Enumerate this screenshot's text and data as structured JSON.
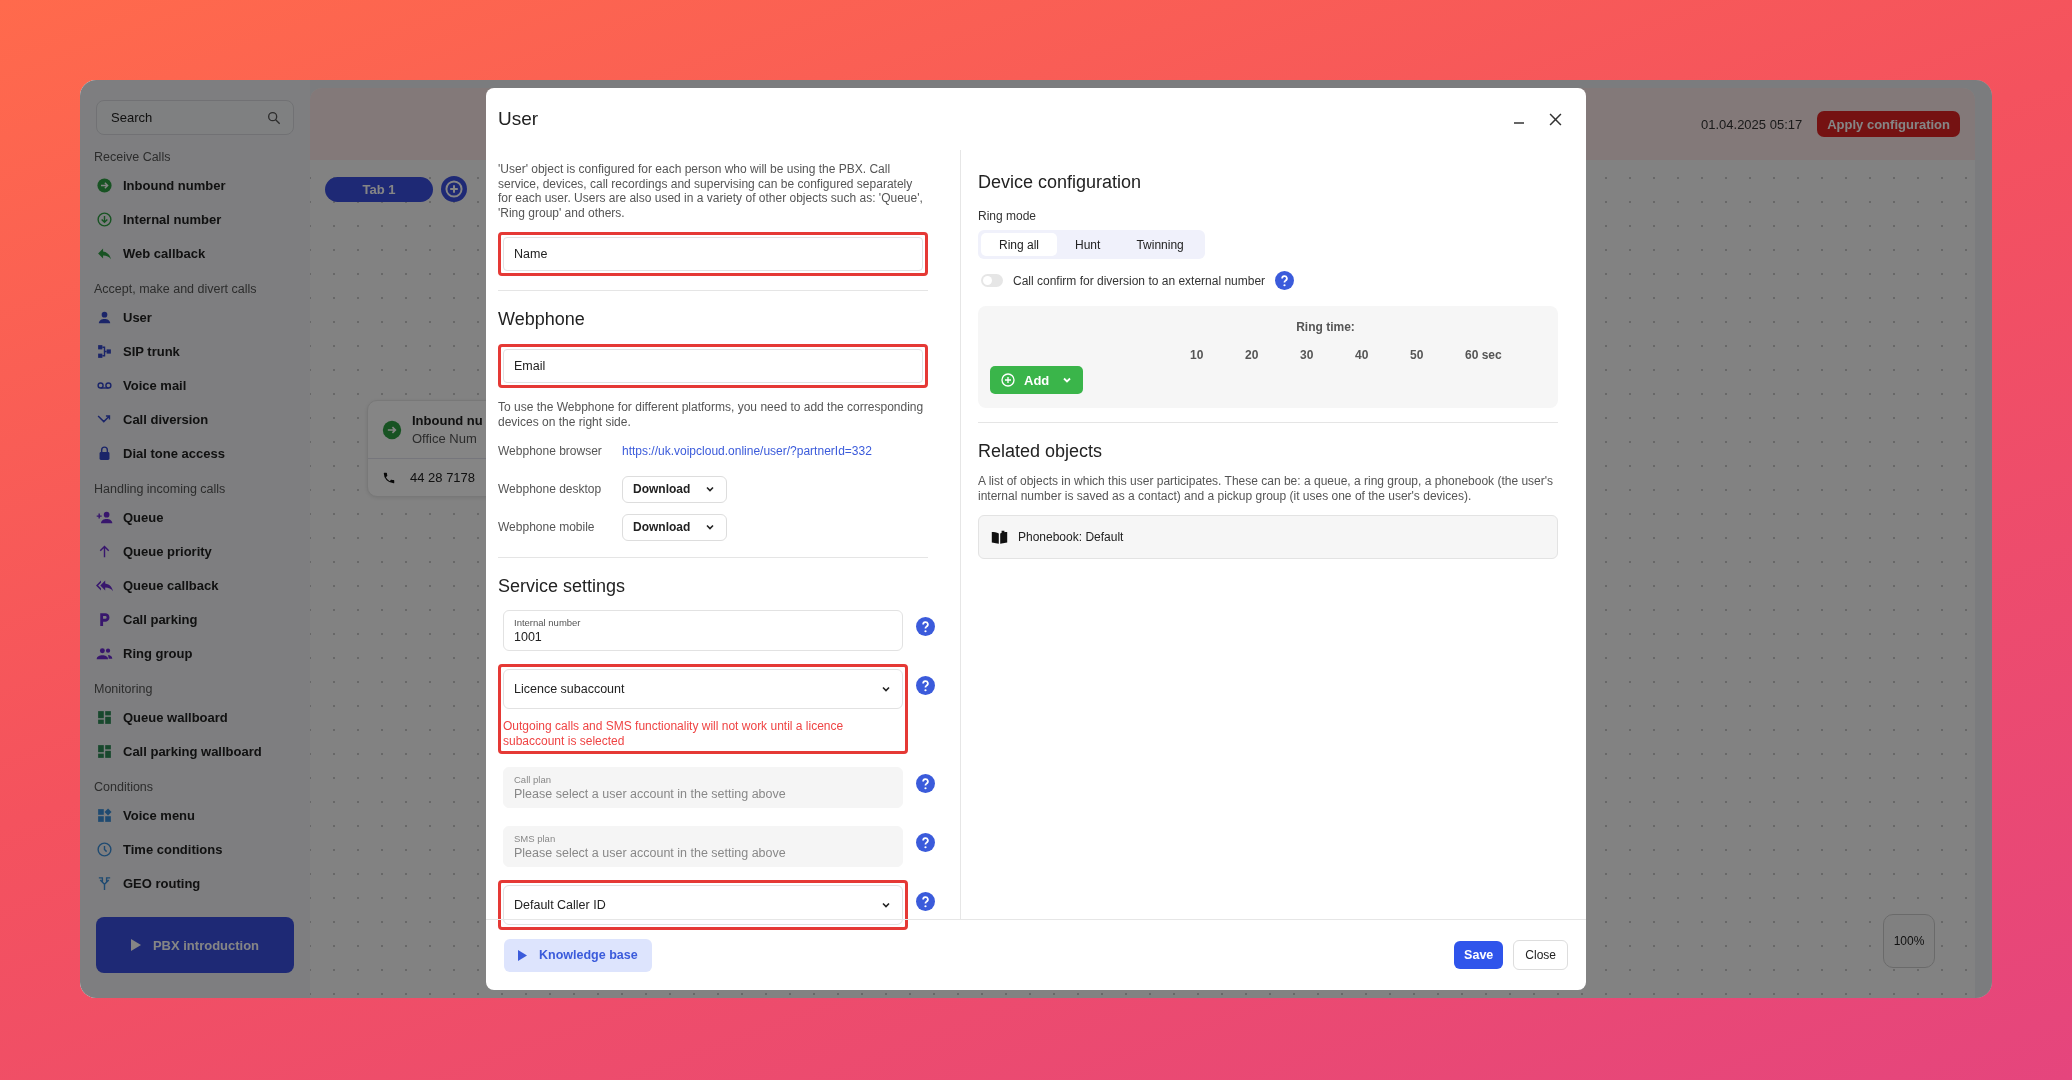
{
  "sidebar": {
    "search": {
      "placeholder": "Search"
    },
    "sections": [
      {
        "title": "Receive Calls",
        "items": [
          {
            "label": "Inbound number"
          },
          {
            "label": "Internal number"
          },
          {
            "label": "Web callback"
          }
        ]
      },
      {
        "title": "Accept, make and divert calls",
        "items": [
          {
            "label": "User"
          },
          {
            "label": "SIP trunk"
          },
          {
            "label": "Voice mail"
          },
          {
            "label": "Call diversion"
          },
          {
            "label": "Dial tone access"
          }
        ]
      },
      {
        "title": "Handling incoming calls",
        "items": [
          {
            "label": "Queue"
          },
          {
            "label": "Queue priority"
          },
          {
            "label": "Queue callback"
          },
          {
            "label": "Call parking"
          },
          {
            "label": "Ring group"
          }
        ]
      },
      {
        "title": "Monitoring",
        "items": [
          {
            "label": "Queue wallboard"
          },
          {
            "label": "Call parking wallboard"
          }
        ]
      },
      {
        "title": "Conditions",
        "items": [
          {
            "label": "Voice menu"
          },
          {
            "label": "Time conditions"
          },
          {
            "label": "GEO routing"
          }
        ]
      }
    ],
    "intro_button": "PBX introduction"
  },
  "canvas": {
    "datetime": "01.04.2025 05:17",
    "apply_button": "Apply configuration",
    "tabs": [
      {
        "label": "Tab 1",
        "selected": true
      }
    ],
    "node": {
      "title": "Inbound nu",
      "subtitle": "Office Num",
      "phone": "44 28 7178"
    },
    "zoom": "100%"
  },
  "dialog": {
    "title": "User",
    "description": "'User' object is configured for each person who will be using the PBX. Call service, devices, call recordings and supervising can be configured separately for each user. Users are also used in a variety of other objects such as: 'Queue', 'Ring group' and others.",
    "name_field": {
      "placeholder": "Name",
      "highlighted": true
    },
    "webphone": {
      "title": "Webphone",
      "email_field": {
        "placeholder": "Email",
        "highlighted": true
      },
      "note": "To use the Webphone for different platforms, you need to add the corresponding devices on the right side.",
      "rows": [
        {
          "kind": "link",
          "label": "Webphone browser",
          "value": "https://uk.voipcloud.online/user/?partnerId=332"
        },
        {
          "kind": "dropdown",
          "label": "Webphone desktop",
          "value": "Download"
        },
        {
          "kind": "dropdown",
          "label": "Webphone mobile",
          "value": "Download"
        }
      ]
    },
    "service_settings": {
      "title": "Service settings",
      "fields": [
        {
          "kind": "text",
          "label": "Internal number",
          "value": "1001",
          "disabled": false,
          "highlighted": false
        },
        {
          "kind": "select",
          "placeholder": "Licence subaccount",
          "error": "Outgoing calls and SMS functionality will not work until a licence subaccount is selected",
          "disabled": false,
          "highlighted": true
        },
        {
          "kind": "text",
          "label": "Call plan",
          "value": "Please select a user account in the setting above",
          "disabled": true,
          "highlighted": false
        },
        {
          "kind": "text",
          "label": "SMS plan",
          "value": "Please select a user account in the setting above",
          "disabled": true,
          "highlighted": false
        },
        {
          "kind": "select",
          "placeholder": "Default Caller ID",
          "disabled": false,
          "highlighted": true
        }
      ]
    },
    "device_configuration": {
      "title": "Device configuration",
      "ring_mode": {
        "label": "Ring mode",
        "options": [
          {
            "label": "Ring all",
            "selected": true
          },
          {
            "label": "Hunt",
            "selected": false
          },
          {
            "label": "Twinning",
            "selected": false
          }
        ]
      },
      "call_confirm": {
        "label": "Call confirm for diversion to an external number",
        "on": false
      },
      "ring_time": {
        "label": "Ring time:",
        "ticks": [
          "10",
          "20",
          "30",
          "40",
          "50",
          "60 sec"
        ]
      },
      "add_button": "Add"
    },
    "related_objects": {
      "title": "Related objects",
      "description": "A list of objects in which this user participates. These can be: a queue, a ring group, a phonebook (the user's internal number is saved as a contact) and a pickup group (it uses one of the user's devices).",
      "items": [
        {
          "label": "Phonebook: Default"
        }
      ]
    },
    "footer": {
      "knowledge_base": "Knowledge base",
      "save": "Save",
      "close": "Close"
    }
  }
}
